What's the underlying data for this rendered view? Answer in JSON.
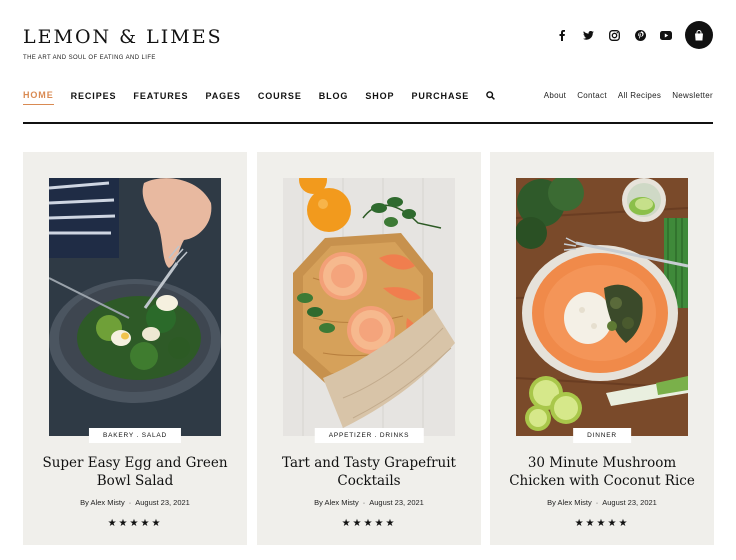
{
  "brand": {
    "name": "LEMON & LIMES",
    "tagline": "THE ART AND SOUL OF EATING AND LIFE"
  },
  "social": [
    "facebook-icon",
    "twitter-icon",
    "instagram-icon",
    "pinterest-icon",
    "youtube-icon"
  ],
  "cart_icon": "shopping-bag-icon",
  "main_nav": {
    "items": [
      "HOME",
      "RECIPES",
      "FEATURES",
      "PAGES",
      "COURSE",
      "BLOG",
      "SHOP",
      "PURCHASE"
    ],
    "active": "HOME",
    "active_color": "#d98a52"
  },
  "secondary_nav": {
    "items": [
      "About",
      "Contact",
      "All Recipes",
      "Newsletter"
    ]
  },
  "cards": [
    {
      "tag": "BAKERY . SALAD",
      "title": "Super Easy Egg and Green Bowl Salad",
      "author": "By Alex Misty",
      "date": "August 23, 2021",
      "rating": "★★★★★"
    },
    {
      "tag": "APPETIZER . DRINKS",
      "title": "Tart and Tasty Grapefruit Cocktails",
      "author": "By Alex Misty",
      "date": "August 23, 2021",
      "rating": "★★★★★"
    },
    {
      "tag": "DINNER",
      "title": "30 Minute Mushroom Chicken with Coconut Rice",
      "author": "By Alex Misty",
      "date": "August 23, 2021",
      "rating": "★★★★★"
    }
  ],
  "colors": {
    "card_bg": "#f0efeb",
    "accent": "#d98a52",
    "text": "#111111"
  }
}
